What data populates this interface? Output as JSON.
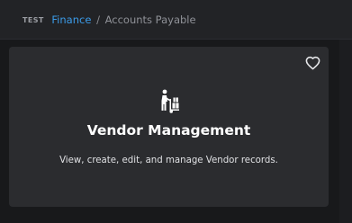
{
  "breadcrumb": {
    "env": "TEST",
    "parent": "Finance",
    "separator": "/",
    "current": "Accounts Payable"
  },
  "card": {
    "icon": "hand-truck-boxes-icon",
    "title": "Vendor Management",
    "description": "View, create, edit, and manage Vendor records.",
    "favorite_icon": "heart-outline-icon"
  },
  "colors": {
    "background": "#18191b",
    "topbar": "#222326",
    "card": "#2b2c2f",
    "link": "#3b9be8",
    "text_primary": "#ffffff"
  }
}
